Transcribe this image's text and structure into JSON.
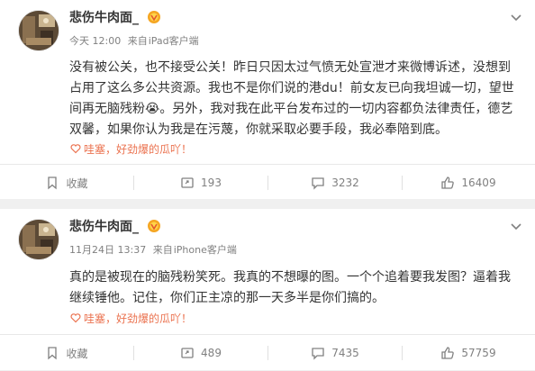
{
  "posts": [
    {
      "username": "悲伤牛肉面_",
      "time": "今天 12:00",
      "from_label": "来自",
      "source": "iPad客户端",
      "text_lines": [
        "没有被公关，也不接受公关！昨日只因太过气愤无处宣泄才来微博诉述，没想到",
        "占用了这么多公共资源。我也不是你们说的港du！前女友已向我坦诚一切，望世",
        "间再无脑残粉😭。另外，我对我在此平台发布过的一切内容都负法律责任，德艺",
        "双馨，如果你认为我是在污蔑，你就采取必要手段，我必奉陪到底。"
      ],
      "sub_text": "哇塞，好劲爆的瓜吖！",
      "actions": [
        {
          "icon": "bookmark-icon",
          "label": "收藏"
        },
        {
          "icon": "share-icon",
          "label": "193"
        },
        {
          "icon": "comment-icon",
          "label": "3232"
        },
        {
          "icon": "like-icon",
          "label": "16409"
        }
      ]
    },
    {
      "username": "悲伤牛肉面_",
      "time": "11月24日 13:37",
      "from_label": "来自",
      "source": "iPhone客户端",
      "text_lines": [
        "真的是被现在的脑残粉笑死。我真的不想曝的图。一个个追着要我发图？逼着我",
        "继续锤他。记住，你们正主凉的那一天多半是你们搞的。"
      ],
      "sub_text": "哇塞，好劲爆的瓜吖！",
      "actions": [
        {
          "icon": "bookmark-icon",
          "label": "收藏"
        },
        {
          "icon": "share-icon",
          "label": "489"
        },
        {
          "icon": "comment-icon",
          "label": "7435"
        },
        {
          "icon": "like-icon",
          "label": "57759"
        }
      ]
    }
  ],
  "colors": {
    "accent": "#eb7350",
    "link": "#eb7350",
    "text": "#333333",
    "muted": "#808080",
    "badge": "#f5a623"
  }
}
